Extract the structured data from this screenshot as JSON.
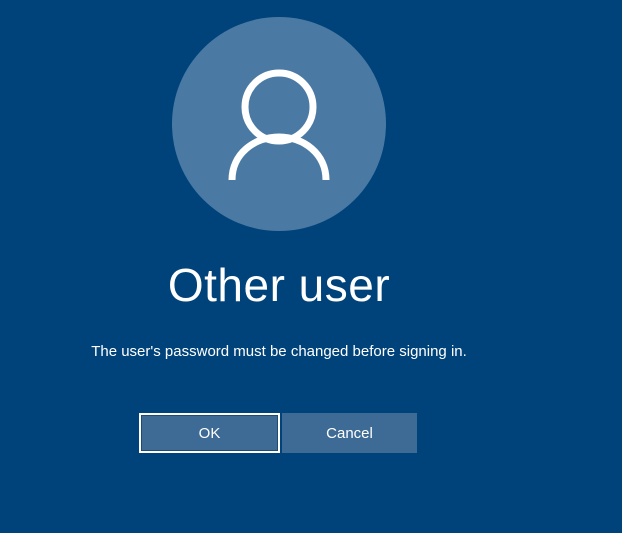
{
  "user": {
    "name": "Other user"
  },
  "message": {
    "text": "The user's password must be changed before signing in."
  },
  "buttons": {
    "ok_label": "OK",
    "cancel_label": "Cancel"
  },
  "colors": {
    "background": "#00437a",
    "avatar_circle": "#4a7aa4",
    "button_fill": "#3d6b95",
    "text": "#ffffff"
  },
  "icons": {
    "avatar": "user-silhouette-icon"
  }
}
